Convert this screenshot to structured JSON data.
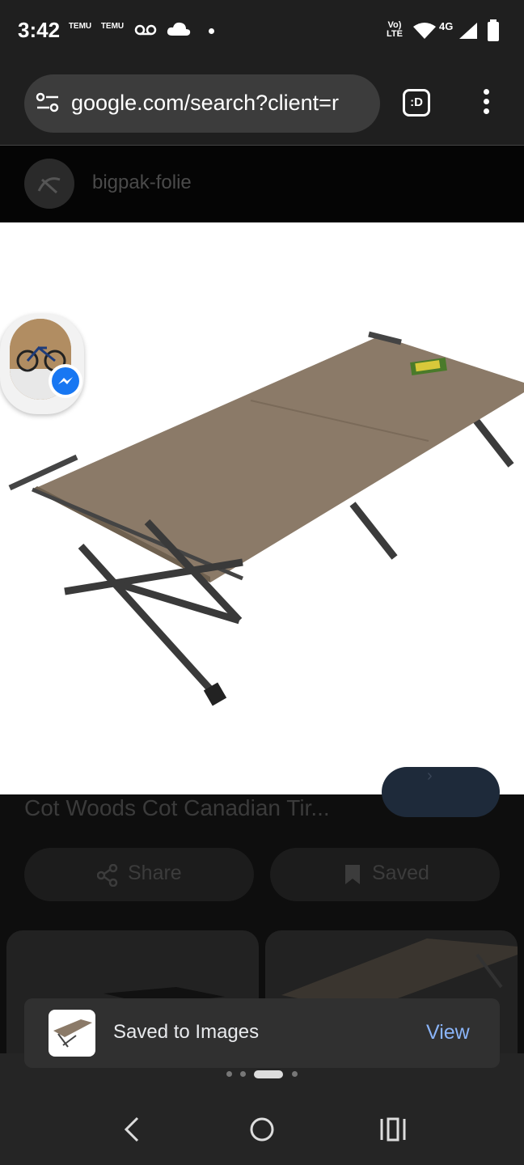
{
  "status_bar": {
    "time": "3:42",
    "notif_icons": [
      "temu-icon",
      "temu-icon",
      "voicemail-icon",
      "cloud-icon",
      "dot-icon"
    ],
    "temu_label": "TEMU",
    "network_label": "Vo)) LTE",
    "signal_label": "4G"
  },
  "browser": {
    "url": "google.com/search?client=r",
    "tab_switcher_label": ":D"
  },
  "result": {
    "source_name": "bigpak-folie",
    "title": "Cot Woods Cot Canadian Tir...",
    "share_label": "Share",
    "saved_label": "Saved"
  },
  "toast": {
    "message": "Saved to Images",
    "action": "View"
  },
  "pagination": {
    "count": 4,
    "active_index": 2
  }
}
